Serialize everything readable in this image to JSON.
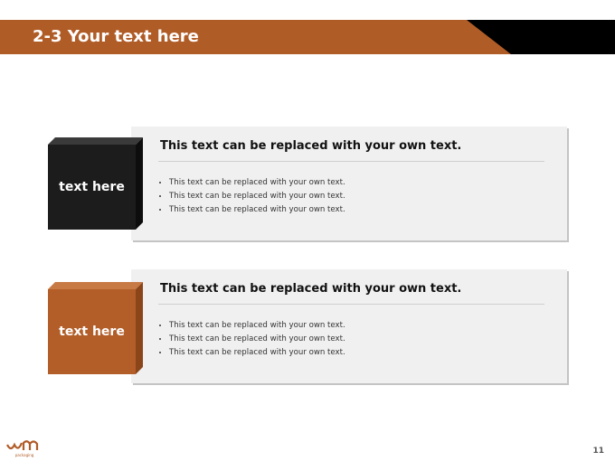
{
  "header": {
    "title": "2-3 Your text here",
    "accent_color": "#b05c27"
  },
  "sections": [
    {
      "label": "text here",
      "color": "#1c1c1c",
      "heading": "This text can be replaced with your own text.",
      "bullets": [
        "This text can be replaced with your own text.",
        "This text can be replaced with your own text.",
        "This text can be replaced with your own text."
      ]
    },
    {
      "label": "text here",
      "color": "#b35e28",
      "heading": "This text can be replaced with your own text.",
      "bullets": [
        "This text can be replaced with your own text.",
        "This text can be replaced with your own text.",
        "This text can be replaced with your own text."
      ]
    }
  ],
  "footer": {
    "logo_text": "packaging",
    "page_number": "11"
  }
}
